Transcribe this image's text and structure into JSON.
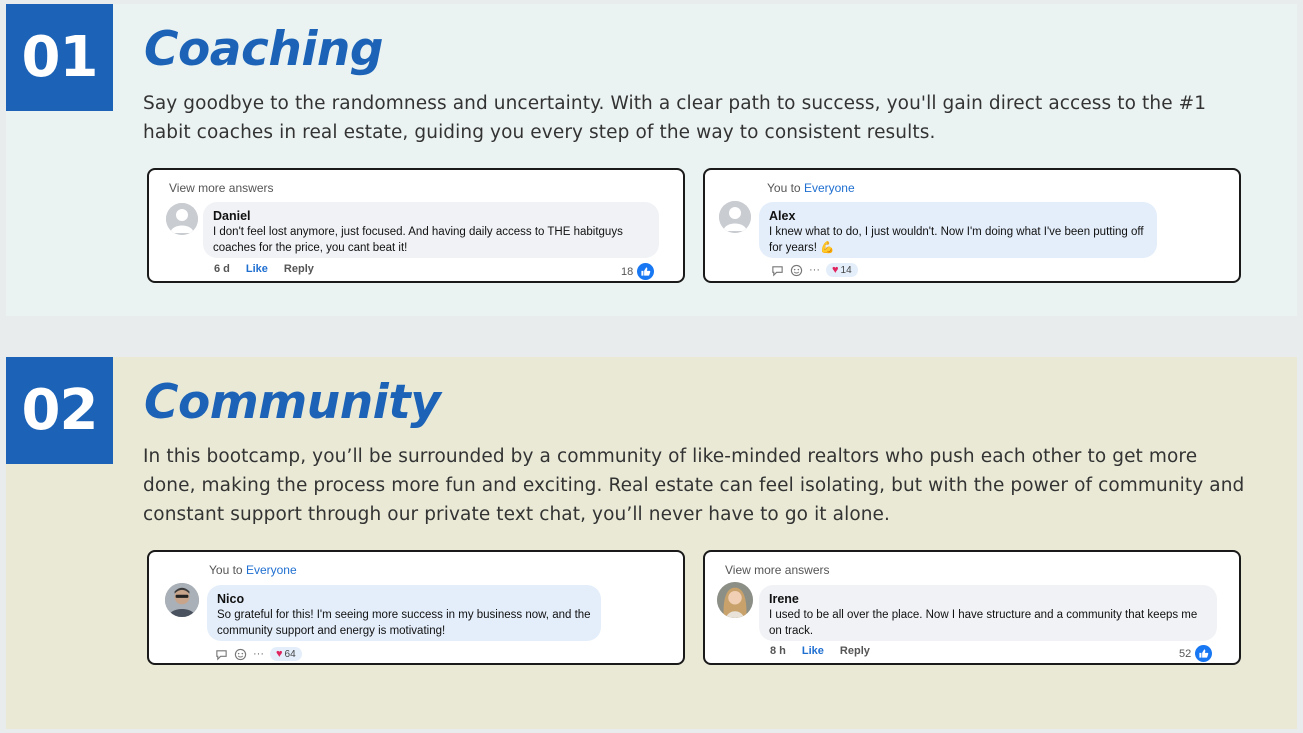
{
  "sections": [
    {
      "number": "01",
      "title": "Coaching",
      "description": "Say goodbye to the randomness and uncertainty. With a clear path to success, you'll gain direct access to the #1 habit coaches in real estate, guiding you every step of the way to consistent results.",
      "cards": [
        {
          "top_text": "View more answers",
          "author": "Daniel",
          "comment": "I don't feel lost anymore, just focused. And having daily access to THE habitguys coaches for the price, you cant beat it!",
          "time": "6 d",
          "like_label": "Like",
          "reply_label": "Reply",
          "like_count": "18"
        },
        {
          "top_prefix": "You to",
          "top_link": "Everyone",
          "author": "Alex",
          "comment": "I knew what to do, I just wouldn't. Now I'm doing what I've been putting off for years! 💪",
          "more": "···",
          "heart_count": "14"
        }
      ]
    },
    {
      "number": "02",
      "title": "Community",
      "description": "In this bootcamp, you’ll be surrounded by a community of like-minded realtors who push each other to get more done, making the process more fun and exciting. Real estate can feel isolating, but with the power of community and constant support through our private text chat, you’ll never have to go it alone.",
      "cards": [
        {
          "top_prefix": "You to",
          "top_link": "Everyone",
          "author": "Nico",
          "comment": "So grateful for this! I'm seeing more success in my business now, and the community support and energy is motivating!",
          "more": "···",
          "heart_count": "64"
        },
        {
          "top_text": "View more answers",
          "author": "Irene",
          "comment": "I used to be all over the place. Now I have structure and a community that keeps me on track.",
          "time": "8 h",
          "like_label": "Like",
          "reply_label": "Reply",
          "like_count": "52"
        }
      ]
    }
  ],
  "colors": {
    "brand_blue": "#1c63b7",
    "like_blue": "#1877f2",
    "heart_red": "#e0245e"
  }
}
